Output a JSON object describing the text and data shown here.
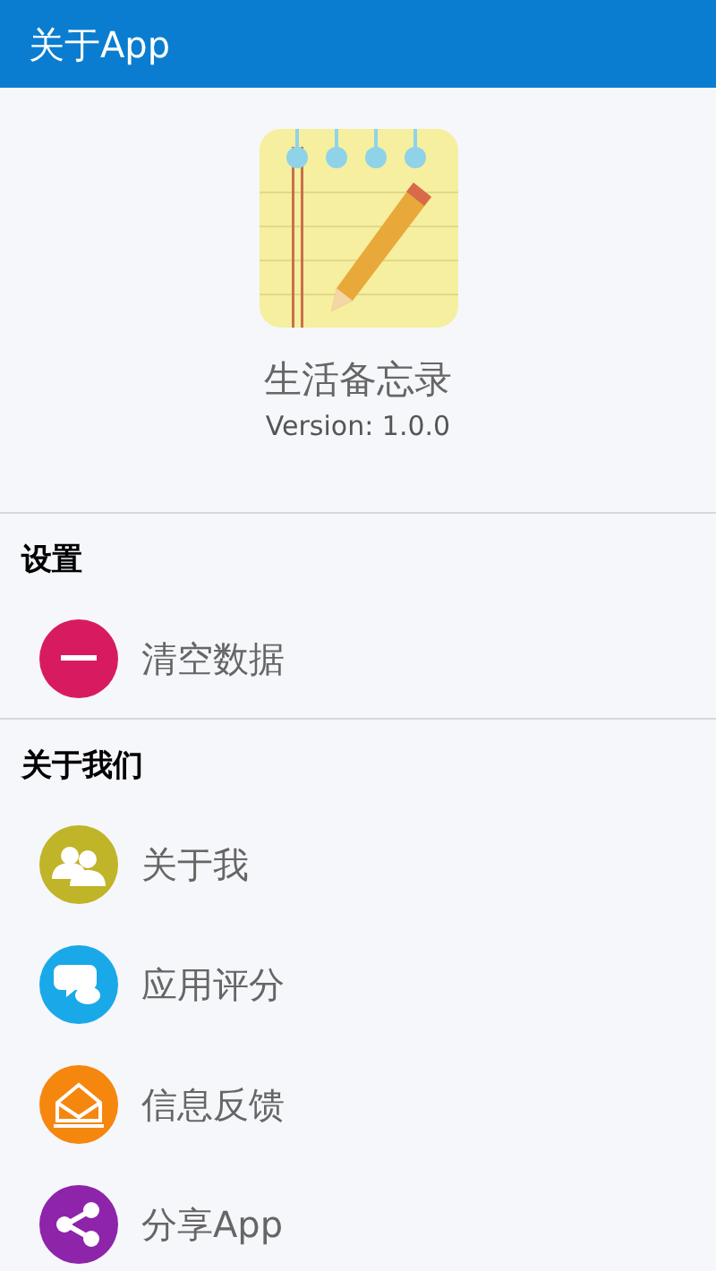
{
  "header": {
    "title": "关于App"
  },
  "app": {
    "name": "生活备忘录",
    "version": "Version: 1.0.0"
  },
  "sections": [
    {
      "title": "设置",
      "items": [
        {
          "label": "清空数据",
          "kind": "clear",
          "color": "#d81b60"
        }
      ]
    },
    {
      "title": "关于我们",
      "items": [
        {
          "label": "关于我",
          "kind": "people",
          "color": "#c0b428"
        },
        {
          "label": "应用评分",
          "kind": "chat",
          "color": "#1aa9e8"
        },
        {
          "label": "信息反馈",
          "kind": "mail",
          "color": "#f5870f"
        },
        {
          "label": "分享App",
          "kind": "share",
          "color": "#8e24aa"
        }
      ]
    }
  ]
}
